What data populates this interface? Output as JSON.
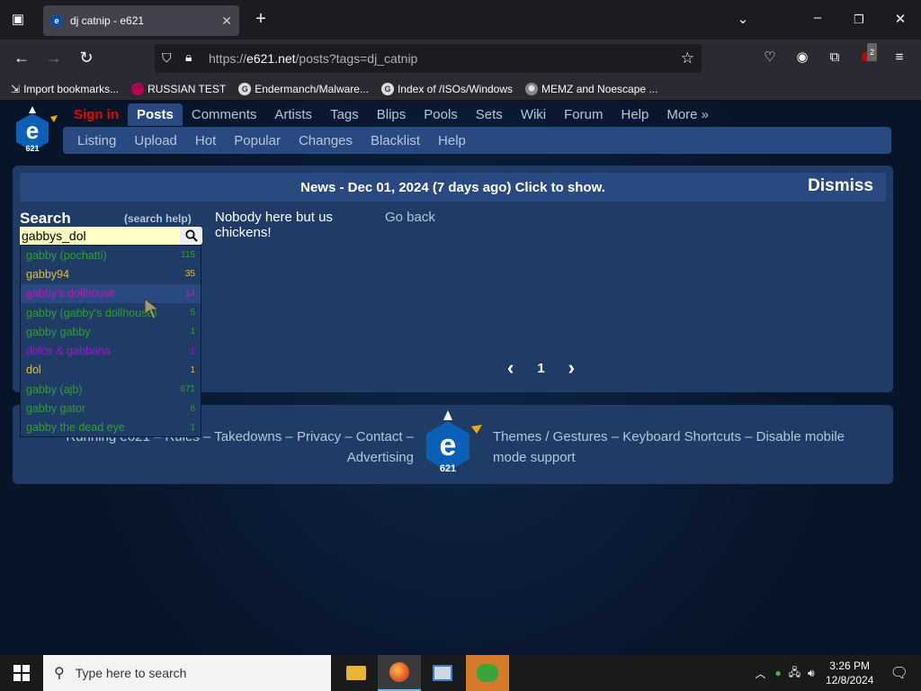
{
  "browser": {
    "tab_title": "dj catnip - e621",
    "url_prefix": "https://",
    "url_domain": "e621.net",
    "url_path": "/posts?tags=dj_catnip",
    "bookmarks": [
      {
        "label": "Import bookmarks..."
      },
      {
        "label": "RUSSIAN TEST"
      },
      {
        "label": "Endermanch/Malware..."
      },
      {
        "label": "Index of /ISOs/Windows"
      },
      {
        "label": "MEMZ and Noescape ..."
      }
    ],
    "extension_badge": "2"
  },
  "site": {
    "top_nav": {
      "sign_in": "Sign in",
      "posts": "Posts",
      "comments": "Comments",
      "artists": "Artists",
      "tags": "Tags",
      "blips": "Blips",
      "pools": "Pools",
      "sets": "Sets",
      "wiki": "Wiki",
      "forum": "Forum",
      "help": "Help",
      "more": "More »"
    },
    "sub_nav": {
      "listing": "Listing",
      "upload": "Upload",
      "hot": "Hot",
      "popular": "Popular",
      "changes": "Changes",
      "blacklist": "Blacklist",
      "help": "Help"
    },
    "news": {
      "message": "News - Dec 01, 2024 (7 days ago) Click to show.",
      "dismiss": "Dismiss"
    },
    "search": {
      "title": "Search",
      "help": "(search help)",
      "value": "gabbys_dol"
    },
    "autocomplete": [
      {
        "name": "gabby (pochatti)",
        "count": "115",
        "color": "#2e9e2e"
      },
      {
        "name": "gabby94",
        "count": "35",
        "color": "#e4b93a"
      },
      {
        "name": "gabby's dollhouse",
        "count": "14",
        "color": "#c014c0"
      },
      {
        "name": "gabby (gabby's dollhouse)",
        "count": "5",
        "color": "#2e9e2e"
      },
      {
        "name": "gabby gabby",
        "count": "1",
        "color": "#2e9e2e"
      },
      {
        "name": "dolce & gabbana",
        "count": "1",
        "color": "#a014d0"
      },
      {
        "name": "dol",
        "count": "1",
        "color": "#e4b93a"
      },
      {
        "name": "gabby (ajb)",
        "count": "671",
        "color": "#2e9e2e"
      },
      {
        "name": "gabby gator",
        "count": "6",
        "color": "#2e9e2e"
      },
      {
        "name": "gabby the dead eye",
        "count": "1",
        "color": "#2e9e2e"
      }
    ],
    "empty_message": "Nobody here but us chickens!",
    "go_back": "Go back",
    "pagination": {
      "prev": "‹",
      "current": "1",
      "next": "›"
    },
    "footer": {
      "left_line1": "Running e621 – Rules – Takedowns – Privacy – Contact –",
      "left_line2": "Advertising",
      "right_line1": "Themes / Gestures – Keyboard Shortcuts – Disable mobile",
      "right_line2": "mode support"
    }
  },
  "taskbar": {
    "search_placeholder": "Type here to search",
    "time": "3:26 PM",
    "date": "12/8/2024"
  }
}
